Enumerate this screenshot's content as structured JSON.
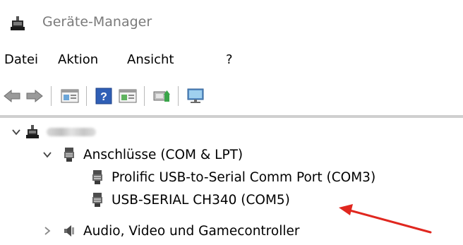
{
  "window": {
    "title": "Geräte-Manager",
    "icon": "device-manager-icon"
  },
  "menu": {
    "items": [
      "Datei",
      "Aktion",
      "Ansicht",
      "?"
    ]
  },
  "toolbar": {
    "buttons": [
      "back-arrow-icon",
      "forward-arrow-icon",
      "properties-icon",
      "help-icon",
      "update-driver-icon",
      "scan-hardware-icon",
      "monitor-icon"
    ]
  },
  "tree": {
    "root": {
      "label": "",
      "icon": "computer-icon",
      "expanded": true
    },
    "ports": {
      "label": "Anschlüsse (COM & LPT)",
      "icon": "port-icon",
      "expanded": true
    },
    "port_children": [
      {
        "label": "Prolific USB-to-Serial Comm Port (COM3)",
        "icon": "port-icon"
      },
      {
        "label": "USB-SERIAL CH340 (COM5)",
        "icon": "port-icon"
      }
    ],
    "audio": {
      "label": "Audio, Video und Gamecontroller",
      "icon": "speaker-icon",
      "expanded": false
    }
  },
  "colors": {
    "annotation_arrow": "#e0271f",
    "title_text": "#7a7a7a"
  }
}
